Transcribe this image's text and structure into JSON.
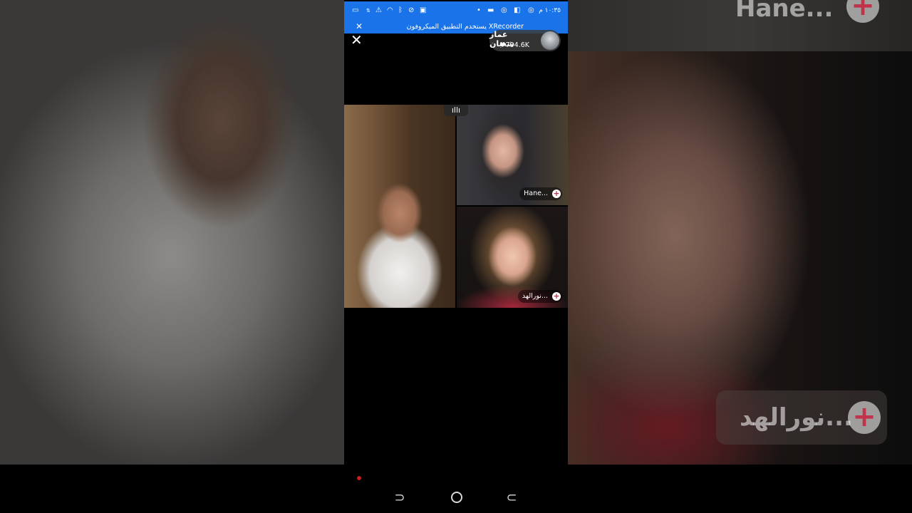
{
  "status_bar": {
    "time": "١٠:٣٥ م",
    "icons": [
      "battery-icon",
      "data-icon",
      "warning-icon",
      "bluetooth-icon",
      "wifi-icon",
      "mute-icon",
      "cast-icon",
      "instagram-icon",
      "message-icon",
      "dot-icon"
    ]
  },
  "notification": {
    "text": "يستخدم التطبيق الميكروفون XRecorder",
    "close_glyph": "✕"
  },
  "live": {
    "close_glyph": "✕",
    "host_name": "عمار شعبان",
    "host_likes": "794.6K",
    "heart_glyph": "♥"
  },
  "participants": [
    {
      "name": "Hane...",
      "plus": "+"
    },
    {
      "name": "نورالهد...",
      "plus": "+"
    }
  ],
  "background_overlay": {
    "name_top": "Hane...",
    "name_bottom": "نورالهد...",
    "plus": "+"
  },
  "audio_indicator": "ıllı",
  "nav": {
    "back_glyph": "⊃",
    "recents_glyph": "⊂"
  },
  "colors": {
    "status_bar": "#1a73e8",
    "recording_dot": "#c81e1e",
    "add_plus": "#c0334a"
  }
}
